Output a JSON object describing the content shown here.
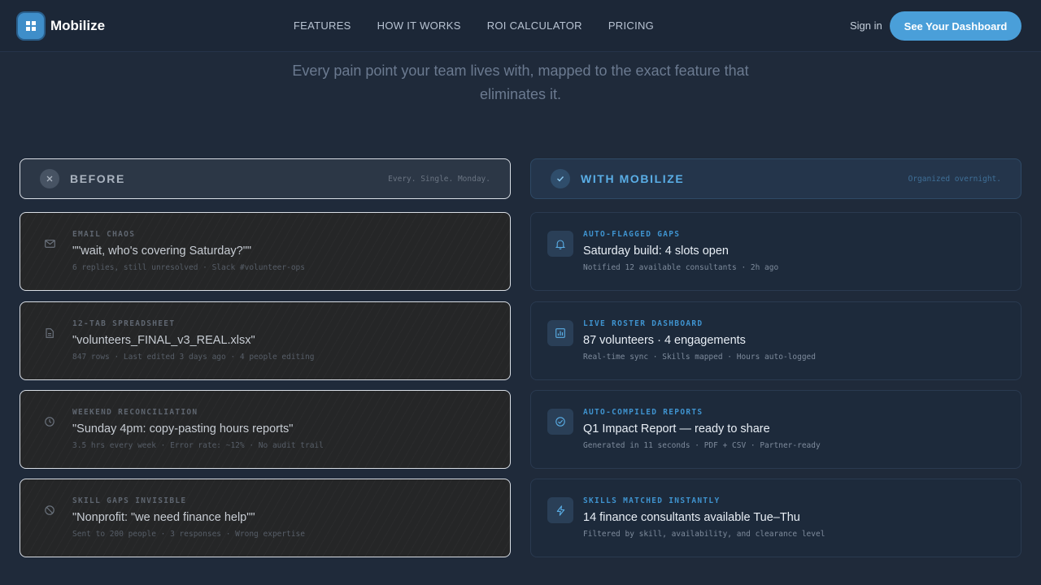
{
  "brand": {
    "name": "Mobilize",
    "logo_icon": "grid-icon"
  },
  "nav": {
    "links": [
      "FEATURES",
      "HOW IT WORKS",
      "ROI CALCULATOR",
      "PRICING"
    ],
    "signin": "Sign in",
    "cta": "See Your Dashboard"
  },
  "subtitle": "Every pain point your team lives with, mapped to the exact feature that eliminates it.",
  "before": {
    "title": "BEFORE",
    "note": "Every. Single. Monday.",
    "icon": "close-icon",
    "items": [
      {
        "label": "EMAIL CHAOS",
        "title": "\"\"wait, who's covering Saturday?\"\"",
        "meta": "6 replies, still unresolved · Slack #volunteer-ops",
        "icon": "mail-icon"
      },
      {
        "label": "12-TAB SPREADSHEET",
        "title": "\"volunteers_FINAL_v3_REAL.xlsx\"",
        "meta": "847 rows · Last edited 3 days ago · 4 people editing",
        "icon": "file-icon"
      },
      {
        "label": "WEEKEND RECONCILIATION",
        "title": "\"Sunday 4pm: copy-pasting hours reports\"",
        "meta": "3.5 hrs every week · Error rate: ~12% · No audit trail",
        "icon": "clock-icon"
      },
      {
        "label": "SKILL GAPS INVISIBLE",
        "title": "\"Nonprofit: \"we need finance help\"\"",
        "meta": "Sent to 200 people · 3 responses · Wrong expertise",
        "icon": "ban-icon"
      }
    ]
  },
  "after": {
    "title": "WITH MOBILIZE",
    "note": "Organized overnight.",
    "icon": "check-icon",
    "items": [
      {
        "label": "AUTO-FLAGGED GAPS",
        "title": "Saturday build: 4 slots open",
        "meta": "Notified 12 available consultants · 2h ago",
        "icon": "bell-icon"
      },
      {
        "label": "LIVE ROSTER DASHBOARD",
        "title": "87 volunteers · 4 engagements",
        "meta": "Real-time sync · Skills mapped · Hours auto-logged",
        "icon": "bar-chart-icon"
      },
      {
        "label": "AUTO-COMPILED REPORTS",
        "title": "Q1 Impact Report — ready to share",
        "meta": "Generated in 11 seconds · PDF + CSV · Partner-ready",
        "icon": "check-circle-icon"
      },
      {
        "label": "SKILLS MATCHED INSTANTLY",
        "title": "14 finance consultants available Tue–Thu",
        "meta": "Filtered by skill, availability, and clearance level",
        "icon": "bolt-icon"
      }
    ]
  },
  "colors": {
    "accent": "#4a9fd9",
    "background": "#1f2a3a",
    "before_border": "#d9dee5"
  }
}
